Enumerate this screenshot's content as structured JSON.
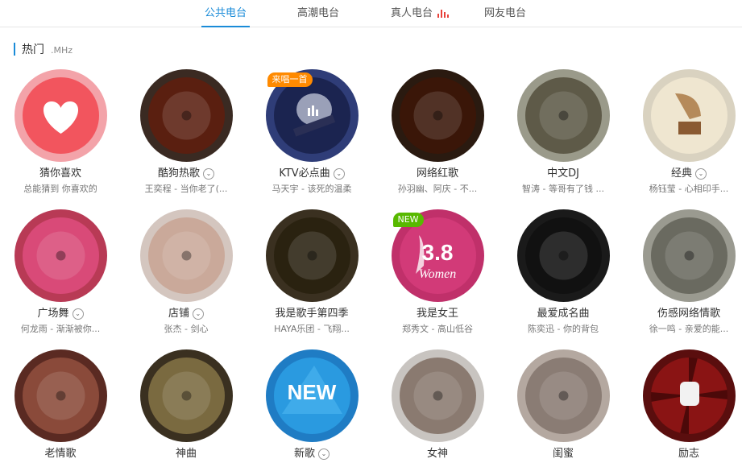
{
  "tabs": [
    {
      "label": "公共电台",
      "active": true
    },
    {
      "label": "高潮电台",
      "active": false
    },
    {
      "label": "真人电台",
      "active": false,
      "icon": "equalizer-icon"
    },
    {
      "label": "网友电台",
      "active": false
    }
  ],
  "section": {
    "title": "热门",
    "subtitle": ".MHz"
  },
  "stations": [
    {
      "name": "猜你喜欢",
      "desc": "总能猜到 你喜欢的",
      "expand": false,
      "ring": "#f3a3a9",
      "fill": "#f2555e",
      "icon": "heart-icon"
    },
    {
      "name": "酷狗热歌",
      "desc": "王奕程 - 当你老了(...",
      "expand": true,
      "ring": "#3a2a22",
      "fill": "#5a1f10",
      "icon": "fire-vinyl-icon"
    },
    {
      "name": "KTV必点曲",
      "desc": "马天宇 - 该死的温柔",
      "expand": true,
      "ring": "#2f3d78",
      "fill": "#1b2450",
      "icon": "microphone-icon",
      "badge": "来唱一首",
      "badge_color": "orange"
    },
    {
      "name": "网络红歌",
      "desc": "孙羽幽、阿庆 - 不...",
      "expand": false,
      "ring": "#2a1a10",
      "fill": "#3a1608",
      "icon": "fire-clef-icon"
    },
    {
      "name": "中文DJ",
      "desc": "智涛 - 等哥有了钱 ...",
      "expand": false,
      "ring": "#9a9a8a",
      "fill": "#5e5a48",
      "icon": "dj-turntable-icon"
    },
    {
      "name": "经典",
      "desc": "杨钰莹 - 心相印手...",
      "expand": true,
      "ring": "#d9d2c0",
      "fill": "#efe6d0",
      "icon": "gramophone-icon"
    },
    {
      "name": "广场舞",
      "desc": "何龙雨 - 渐渐被你...",
      "expand": true,
      "ring": "#b83a55",
      "fill": "#d94a78",
      "icon": "dancers-icon"
    },
    {
      "name": "店铺",
      "desc": "张杰 - 剑心",
      "expand": true,
      "ring": "#d4c6bf",
      "fill": "#caa99a",
      "icon": "shopping-bags-icon"
    },
    {
      "name": "我是歌手第四季",
      "desc": "HAYA乐团 - 飞翔...",
      "expand": false,
      "ring": "#3a3020",
      "fill": "#2a2210",
      "icon": "trophy-logo-icon"
    },
    {
      "name": "我是女王",
      "desc": "郑秀文 - 高山低谷",
      "expand": false,
      "ring": "#c0306a",
      "fill": "#d23a78",
      "icon": "women-day-icon",
      "badge": "NEW",
      "badge_color": "green",
      "art_text": "3.8",
      "art_sub": "Women"
    },
    {
      "name": "最爱成名曲",
      "desc": "陈奕迅 - 你的背包",
      "expand": false,
      "ring": "#1a1a1a",
      "fill": "#111111",
      "icon": "vintage-mic-icon"
    },
    {
      "name": "伤感网络情歌",
      "desc": "徐一鸣 - 亲爱的能...",
      "expand": false,
      "ring": "#9a9a90",
      "fill": "#6a6a60",
      "icon": "portrait-icon"
    },
    {
      "name": "老情歌",
      "desc": "",
      "expand": false,
      "ring": "#5a2a22",
      "fill": "#8a4a3a",
      "icon": "singer-portrait-icon"
    },
    {
      "name": "神曲",
      "desc": "",
      "expand": false,
      "ring": "#3a3020",
      "fill": "#7a6a40",
      "icon": "gangnam-icon"
    },
    {
      "name": "新歌",
      "desc": "",
      "expand": true,
      "ring": "#1f7cc4",
      "fill": "#2a9ae0",
      "icon": "new-logo-icon",
      "art_text": "NEW"
    },
    {
      "name": "女神",
      "desc": "",
      "expand": false,
      "ring": "#c8c4c0",
      "fill": "#8a7a70",
      "icon": "goddess-portrait-icon"
    },
    {
      "name": "闺蜜",
      "desc": "",
      "expand": false,
      "ring": "#b4a8a0",
      "fill": "#8a7c74",
      "icon": "friends-photo-icon"
    },
    {
      "name": "励志",
      "desc": "",
      "expand": false,
      "ring": "#5a0e0e",
      "fill": "#8a1414",
      "icon": "raised-fist-icon"
    }
  ]
}
